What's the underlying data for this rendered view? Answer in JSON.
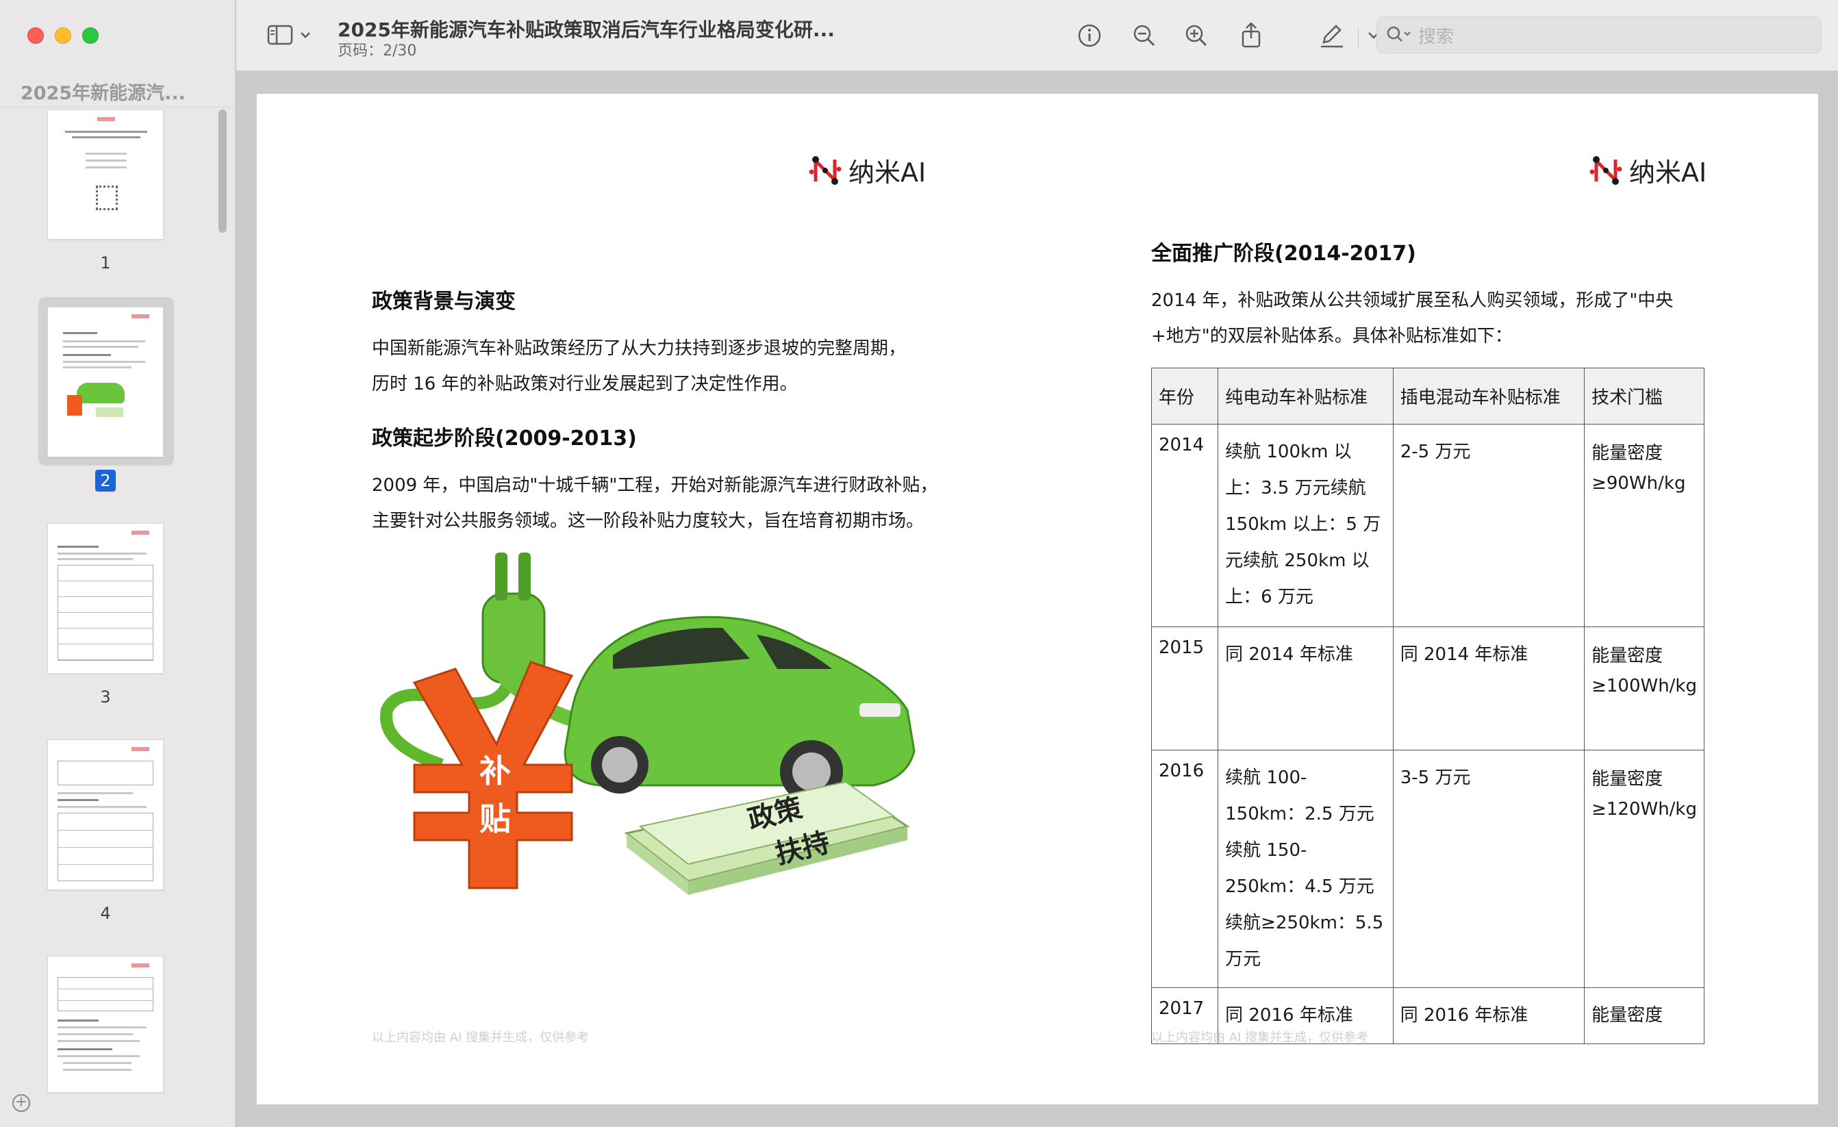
{
  "sidebar": {
    "title": "2025年新能源汽...",
    "thumbnails": [
      {
        "label": "1"
      },
      {
        "label": "2",
        "selected": true
      },
      {
        "label": "3"
      },
      {
        "label": "4"
      },
      {
        "label": ""
      }
    ]
  },
  "toolbar": {
    "doc_title": "2025年新能源汽车补贴政策取消后汽车行业格局变化研...",
    "page_indicator": "页码：2/30",
    "search_placeholder": "搜索"
  },
  "page_left": {
    "logo_text": "纳米AI",
    "h_policy_background": "政策背景与演变",
    "p_policy_background": "中国新能源汽车补贴政策经历了从大力扶持到逐步退坡的完整周期，历时 16 年的补贴政策对行业发展起到了决定性作用。",
    "h_start_phase": "政策起步阶段(2009-2013)",
    "p_start_phase": "2009 年，中国启动\"十城千辆\"工程，开始对新能源汽车进行财政补贴，主要针对公共服务领域。这一阶段补贴力度较大，旨在培育初期市场。",
    "illustration": {
      "yuan_label_1": "补",
      "yuan_label_2": "贴",
      "money_label_1": "政策",
      "money_label_2": "扶持"
    },
    "footer": "以上内容均由 AI 搜集并生成，仅供参考"
  },
  "page_right": {
    "logo_text": "纳米AI",
    "h_full_phase": "全面推广阶段(2014-2017)",
    "p_full_phase": "2014 年，补贴政策从公共领域扩展至私人购买领域，形成了\"中央+地方\"的双层补贴体系。具体补贴标准如下：",
    "table": {
      "headers": [
        "年份",
        "纯电动车补贴标准",
        "插电混动车补贴标准",
        "技术门槛"
      ],
      "rows": [
        [
          "2014",
          "续航 100km 以上：3.5 万元续航 150km 以上：5 万元续航 250km 以上：6 万元",
          "2-5 万元",
          "能量密度≥90Wh/kg"
        ],
        [
          "2015",
          "同 2014 年标准",
          "同 2014 年标准",
          "能量密度≥100Wh/kg"
        ],
        [
          "2016",
          "续航 100-150km：2.5 万元续航 150-250km：4.5 万元续航≥250km：5.5 万元",
          "3-5 万元",
          "能量密度≥120Wh/kg"
        ],
        [
          "2017",
          "同 2016 年标准",
          "同 2016 年标准",
          "能量密度"
        ]
      ]
    },
    "footer": "以上内容均由 AI 搜集并生成，仅供参考"
  }
}
